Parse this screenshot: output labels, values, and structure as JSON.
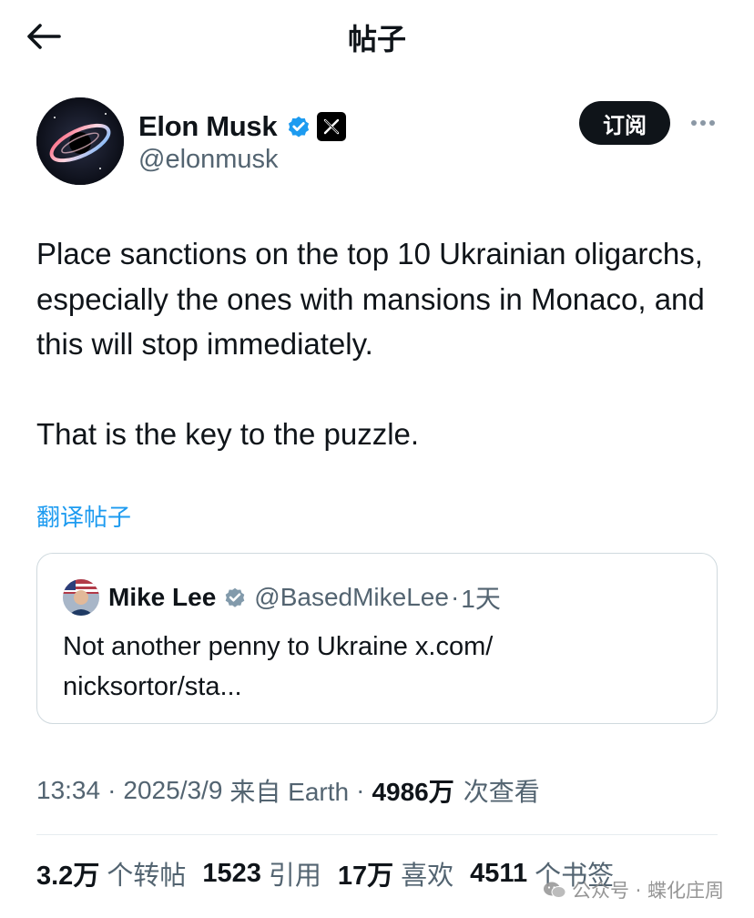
{
  "header": {
    "title": "帖子"
  },
  "author": {
    "name": "Elon Musk",
    "handle": "@elonmusk",
    "subscribe_label": "订阅"
  },
  "tweet": {
    "paragraphs": [
      "Place sanctions on the top 10 Ukrainian oligarchs, especially the ones with mansions in Monaco, and this will stop immediately.",
      "That is the key to the puzzle."
    ],
    "translate_label": "翻译帖子"
  },
  "quote": {
    "name": "Mike Lee",
    "handle": "@BasedMikeLee",
    "separator": "·",
    "time": "1天",
    "text_line1": "Not another penny to Ukraine x.com/",
    "text_line2": "nicksortor/sta..."
  },
  "meta": {
    "time": "13:34",
    "separator": "·",
    "date": "2025/3/9",
    "source": "来自 Earth",
    "views_count": "4986万",
    "views_label": "次查看"
  },
  "stats": {
    "reposts_count": "3.2万",
    "reposts_label": "个转帖",
    "quotes_count": "1523",
    "quotes_label": "引用",
    "likes_count": "17万",
    "likes_label": "喜欢",
    "bookmarks_count": "4511",
    "bookmarks_label": "个书签"
  },
  "watermark": {
    "text": "公众号 · 蝶化庄周"
  },
  "colors": {
    "link": "#1d9bf0",
    "verified": "#1d9bf0",
    "secondary_text": "#536471",
    "primary_text": "#0f1419"
  },
  "icons": {
    "back": "arrow-left-icon",
    "verified": "verified-badge-icon",
    "x_logo": "x-logo-icon",
    "more": "more-horizontal-icon"
  }
}
